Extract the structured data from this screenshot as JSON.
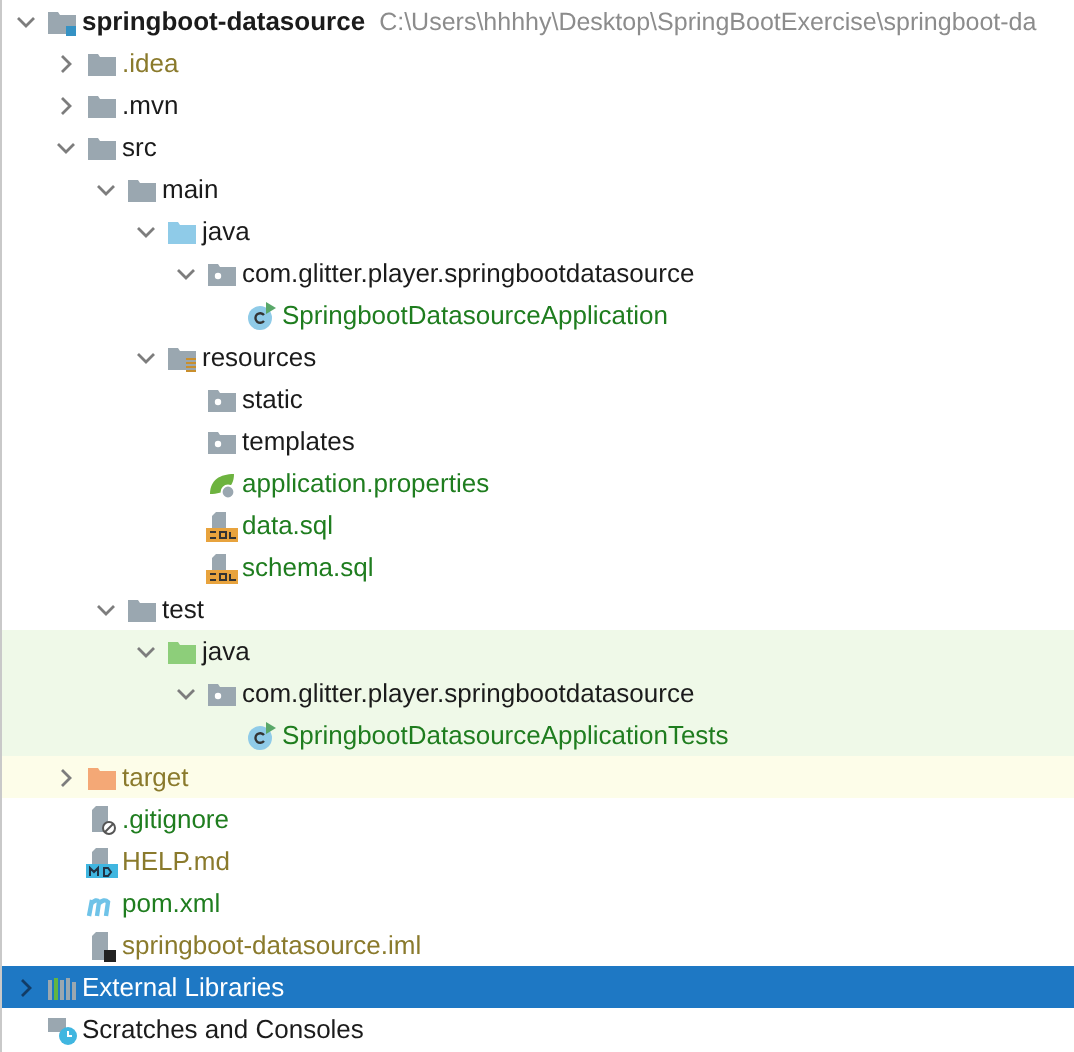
{
  "tree": [
    {
      "label": "springboot-datasource",
      "kind": "module",
      "path": "C:\\Users\\hhhhy\\Desktop\\SpringBootExercise\\springboot-da",
      "vcs_added": false,
      "vcs_ignored": false,
      "expanded": true,
      "selected": false,
      "children": [
        {
          "label": ".idea",
          "kind": "folder",
          "vcs_added": false,
          "vcs_ignored": true,
          "expanded": false,
          "selected": false
        },
        {
          "label": ".mvn",
          "kind": "folder",
          "vcs_added": false,
          "vcs_ignored": false,
          "expanded": false,
          "selected": false
        },
        {
          "label": "src",
          "kind": "folder",
          "vcs_added": false,
          "vcs_ignored": false,
          "expanded": true,
          "selected": false,
          "children": [
            {
              "label": "main",
              "kind": "folder",
              "vcs_added": false,
              "vcs_ignored": false,
              "expanded": true,
              "selected": false,
              "children": [
                {
                  "label": "java",
                  "kind": "source-root",
                  "vcs_added": false,
                  "vcs_ignored": false,
                  "expanded": true,
                  "selected": false,
                  "children": [
                    {
                      "label": "com.glitter.player.springbootdatasource",
                      "kind": "package",
                      "vcs_added": false,
                      "vcs_ignored": false,
                      "expanded": true,
                      "selected": false,
                      "children": [
                        {
                          "label": "SpringbootDatasourceApplication",
                          "kind": "class",
                          "vcs_added": true,
                          "vcs_ignored": false,
                          "selected": false
                        }
                      ]
                    }
                  ]
                },
                {
                  "label": "resources",
                  "kind": "resources-root",
                  "vcs_added": false,
                  "vcs_ignored": false,
                  "expanded": true,
                  "selected": false,
                  "children": [
                    {
                      "label": "static",
                      "kind": "package",
                      "vcs_added": false,
                      "vcs_ignored": false,
                      "selected": false
                    },
                    {
                      "label": "templates",
                      "kind": "package",
                      "vcs_added": false,
                      "vcs_ignored": false,
                      "selected": false
                    },
                    {
                      "label": "application.properties",
                      "kind": "properties",
                      "vcs_added": true,
                      "vcs_ignored": false,
                      "selected": false
                    },
                    {
                      "label": "data.sql",
                      "kind": "sql",
                      "vcs_added": true,
                      "vcs_ignored": false,
                      "selected": false
                    },
                    {
                      "label": "schema.sql",
                      "kind": "sql",
                      "vcs_added": true,
                      "vcs_ignored": false,
                      "selected": false
                    }
                  ]
                }
              ]
            },
            {
              "label": "test",
              "kind": "folder",
              "vcs_added": false,
              "vcs_ignored": false,
              "expanded": true,
              "selected": false,
              "children": [
                {
                  "label": "java",
                  "kind": "test-root",
                  "vcs_added": false,
                  "vcs_ignored": false,
                  "expanded": true,
                  "selected": false,
                  "children": [
                    {
                      "label": "com.glitter.player.springbootdatasource",
                      "kind": "package",
                      "vcs_added": false,
                      "vcs_ignored": false,
                      "expanded": true,
                      "selected": false,
                      "children": [
                        {
                          "label": "SpringbootDatasourceApplicationTests",
                          "kind": "class",
                          "vcs_added": true,
                          "vcs_ignored": false,
                          "selected": false
                        }
                      ]
                    }
                  ]
                }
              ]
            }
          ]
        },
        {
          "label": "target",
          "kind": "excluded",
          "vcs_added": false,
          "vcs_ignored": true,
          "expanded": false,
          "selected": false
        },
        {
          "label": ".gitignore",
          "kind": "gitignore",
          "vcs_added": true,
          "vcs_ignored": false,
          "selected": false
        },
        {
          "label": "HELP.md",
          "kind": "markdown",
          "vcs_added": false,
          "vcs_ignored": true,
          "selected": false
        },
        {
          "label": "pom.xml",
          "kind": "maven",
          "vcs_added": true,
          "vcs_ignored": false,
          "selected": false
        },
        {
          "label": "springboot-datasource.iml",
          "kind": "iml",
          "vcs_added": false,
          "vcs_ignored": true,
          "selected": false
        }
      ]
    },
    {
      "label": "External Libraries",
      "kind": "libraries",
      "vcs_added": false,
      "vcs_ignored": false,
      "expanded": false,
      "selected": true
    },
    {
      "label": "Scratches and Consoles",
      "kind": "scratches",
      "vcs_added": false,
      "vcs_ignored": false,
      "selected": false
    }
  ]
}
